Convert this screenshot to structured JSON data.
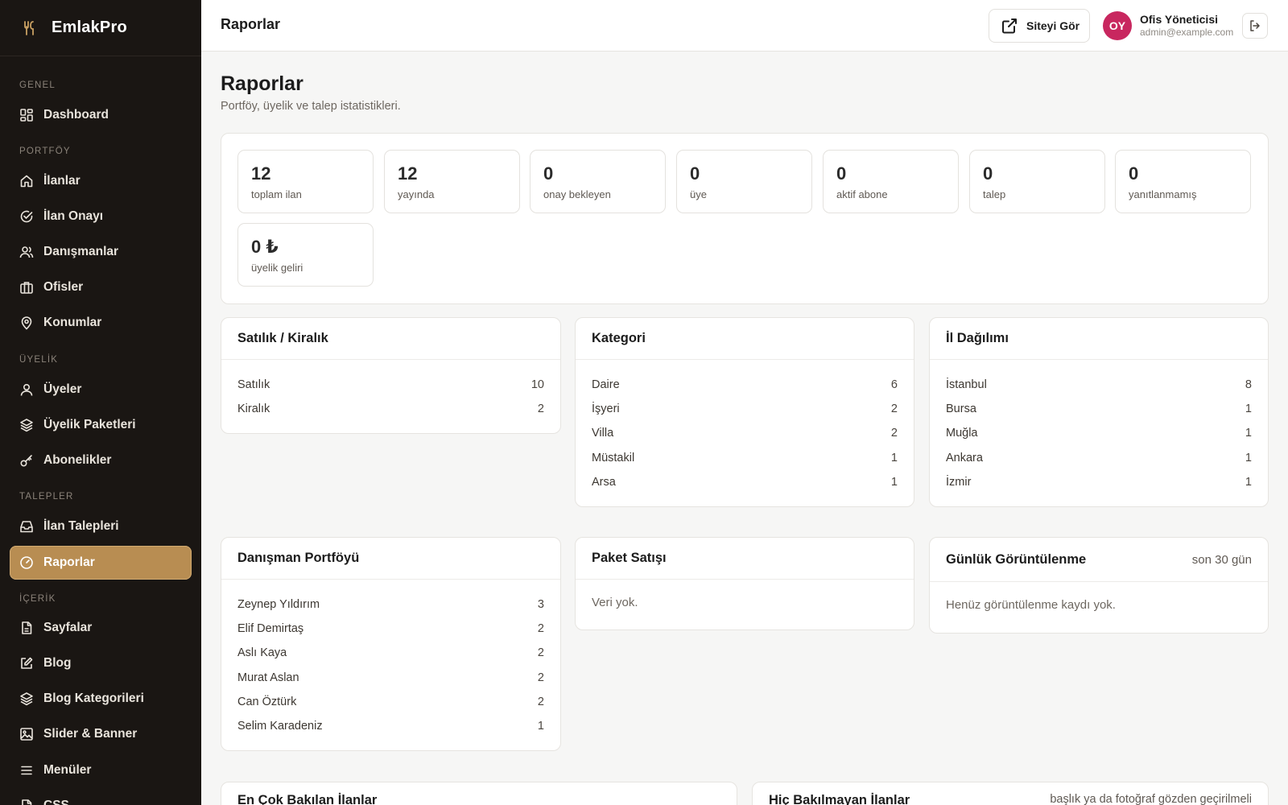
{
  "sidebar": {
    "brand": "EmlakPro",
    "sections": {
      "genel": "GENEL",
      "portfoy": "PORTFÖY",
      "uyelik": "ÜYELİK",
      "talepler": "TALEPLER",
      "icerik": "İÇERİK"
    },
    "items": {
      "dashboard": "Dashboard",
      "ilanlar": "İlanlar",
      "ilan_onayi": "İlan Onayı",
      "danismanlar": "Danışmanlar",
      "ofisler": "Ofisler",
      "konumlar": "Konumlar",
      "uyeler": "Üyeler",
      "uyelik_paketleri": "Üyelik Paketleri",
      "abonelikler": "Abonelikler",
      "ilan_talepleri": "İlan Talepleri",
      "raporlar": "Raporlar",
      "sayfalar": "Sayfalar",
      "blog": "Blog",
      "blog_kategorileri": "Blog Kategorileri",
      "slider_banner": "Slider & Banner",
      "menuler": "Menüler",
      "css": "CSS"
    }
  },
  "topbar": {
    "title": "Raporlar",
    "site_button": "Siteyi Gör",
    "user_initials": "OY",
    "user_name": "Ofis Yöneticisi",
    "user_email": "admin@example.com"
  },
  "page": {
    "title": "Raporlar",
    "subtitle": "Portföy, üyelik ve talep istatistikleri."
  },
  "stats": [
    {
      "value": "12",
      "label": "toplam ilan"
    },
    {
      "value": "12",
      "label": "yayında"
    },
    {
      "value": "0",
      "label": "onay bekleyen"
    },
    {
      "value": "0",
      "label": "üye"
    },
    {
      "value": "0",
      "label": "aktif abone"
    },
    {
      "value": "0",
      "label": "talep"
    },
    {
      "value": "0",
      "label": "yanıtlanmamış"
    },
    {
      "value": "0 ₺",
      "label": "üyelik geliri"
    }
  ],
  "satilik_kiralik": {
    "title": "Satılık / Kiralık",
    "rows": [
      {
        "label": "Satılık",
        "value": "10"
      },
      {
        "label": "Kiralık",
        "value": "2"
      }
    ]
  },
  "kategori": {
    "title": "Kategori",
    "rows": [
      {
        "label": "Daire",
        "value": "6"
      },
      {
        "label": "İşyeri",
        "value": "2"
      },
      {
        "label": "Villa",
        "value": "2"
      },
      {
        "label": "Müstakil",
        "value": "1"
      },
      {
        "label": "Arsa",
        "value": "1"
      }
    ]
  },
  "il_dagilimi": {
    "title": "İl Dağılımı",
    "rows": [
      {
        "label": "İstanbul",
        "value": "8"
      },
      {
        "label": "Bursa",
        "value": "1"
      },
      {
        "label": "Muğla",
        "value": "1"
      },
      {
        "label": "Ankara",
        "value": "1"
      },
      {
        "label": "İzmir",
        "value": "1"
      }
    ]
  },
  "danisman_portfoyu": {
    "title": "Danışman Portföyü",
    "rows": [
      {
        "label": "Zeynep Yıldırım",
        "value": "3"
      },
      {
        "label": "Elif Demirtaş",
        "value": "2"
      },
      {
        "label": "Aslı Kaya",
        "value": "2"
      },
      {
        "label": "Murat Aslan",
        "value": "2"
      },
      {
        "label": "Can Öztürk",
        "value": "2"
      },
      {
        "label": "Selim Karadeniz",
        "value": "1"
      }
    ]
  },
  "paket_satisi": {
    "title": "Paket Satışı",
    "empty": "Veri yok."
  },
  "gunluk_goruntulenme": {
    "title": "Günlük Görüntülenme",
    "note": "son 30 gün",
    "empty": "Henüz görüntülenme kaydı yok."
  },
  "en_cok_bakilan": {
    "title": "En Çok Bakılan İlanlar"
  },
  "hic_bakilmayan": {
    "title": "Hiç Bakılmayan İlanlar",
    "note": "başlık ya da fotoğraf gözden geçirilmeli"
  }
}
